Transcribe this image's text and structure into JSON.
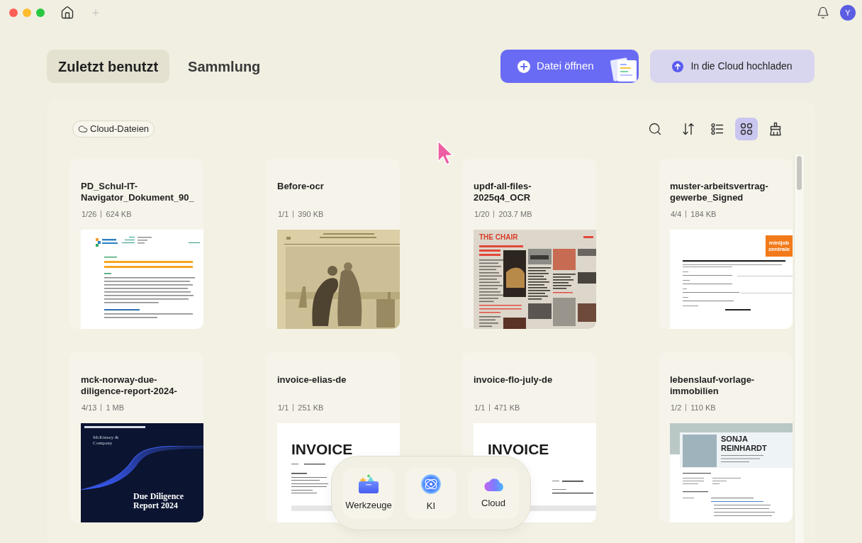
{
  "title_bar": {
    "avatar": "Y"
  },
  "tabs": [
    {
      "label": "Zuletzt benutzt",
      "selected": true
    },
    {
      "label": "Sammlung",
      "selected": false
    }
  ],
  "actions": [
    {
      "kind": "open",
      "label": "Datei öffnen"
    },
    {
      "kind": "upload",
      "label": "In die Cloud hochladen"
    }
  ],
  "filter": {
    "label": "Cloud-Dateien"
  },
  "view_tools": [
    {
      "kind": "search",
      "selected": false
    },
    {
      "kind": "sort",
      "selected": false
    },
    {
      "kind": "list",
      "selected": false
    },
    {
      "kind": "grid",
      "selected": true
    },
    {
      "kind": "clean",
      "selected": false
    }
  ],
  "files": [
    {
      "name": "PD_Schul-IT-Navigator_Dokument_90_",
      "pages": "1/26",
      "size": "624 KB",
      "preview": {
        "kind": "guide"
      }
    },
    {
      "name": "Before-ocr",
      "pages": "1/1",
      "size": "390 KB",
      "preview": {
        "kind": "engraving"
      }
    },
    {
      "name": "updf-all-files-2025q4_OCR",
      "pages": "1/20",
      "size": "203.7 MB",
      "preview": {
        "kind": "magazine",
        "title": "THE CHAIR"
      }
    },
    {
      "name": "muster-arbeitsvertrag-gewerbe_Signed",
      "pages": "4/4",
      "size": "184 KB",
      "preview": {
        "kind": "contract",
        "logo": "minijob zentrale"
      }
    },
    {
      "name": "mck-norway-due-diligence-report-2024-",
      "pages": "4/13",
      "size": "1 MB",
      "preview": {
        "kind": "report",
        "brand": "McKinsey & Company",
        "title": "Due Diligence Report 2024"
      }
    },
    {
      "name": "invoice-elias-de",
      "pages": "1/1",
      "size": "251 KB",
      "preview": {
        "kind": "invoice",
        "title": "INVOICE",
        "billing_block": true,
        "sender_block": false
      }
    },
    {
      "name": "invoice-flo-july-de",
      "pages": "1/1",
      "size": "471 KB",
      "preview": {
        "kind": "invoice",
        "title": "INVOICE",
        "billing_block": false,
        "sender_block": true
      }
    },
    {
      "name": "lebenslauf-vorlage-immobilien",
      "pages": "1/2",
      "size": "110 KB",
      "preview": {
        "kind": "resume",
        "title": "SONJA REINHARDT"
      }
    }
  ],
  "dock": [
    {
      "kind": "tools",
      "label": "Werkzeuge"
    },
    {
      "kind": "ai",
      "label": "KI"
    },
    {
      "kind": "cloud",
      "label": "Cloud"
    }
  ]
}
